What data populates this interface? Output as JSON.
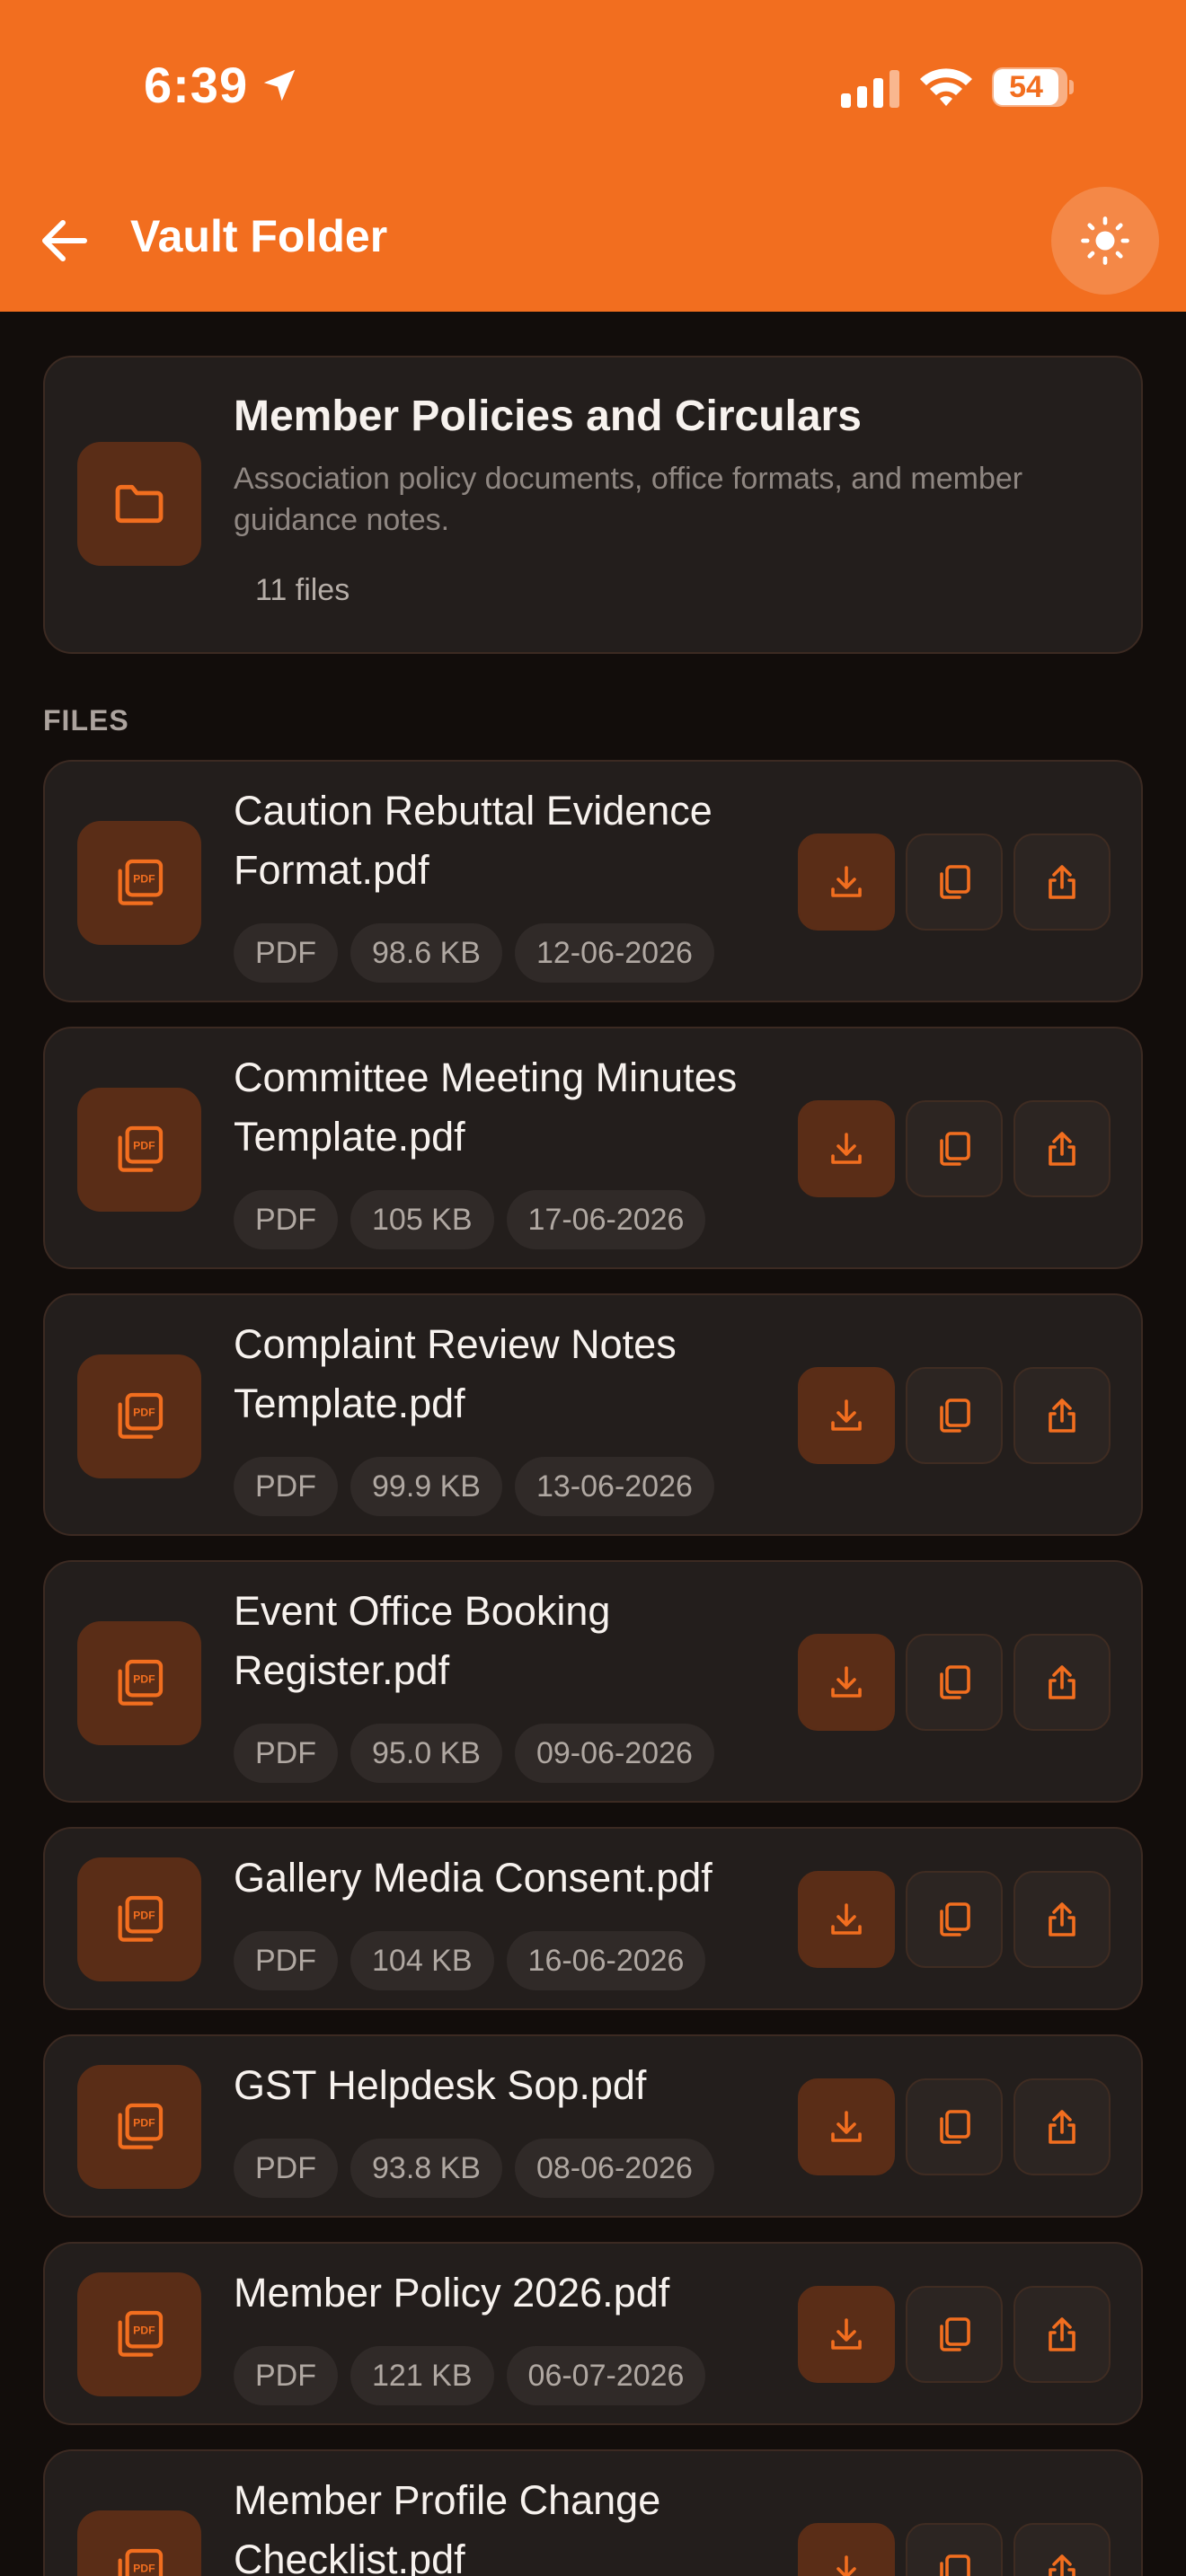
{
  "status": {
    "time": "6:39",
    "battery": "54"
  },
  "header": {
    "title": "Vault Folder"
  },
  "folder": {
    "name": "Member Policies and Circulars",
    "description": "Association policy documents, office formats, and member guidance notes.",
    "count": "11 files"
  },
  "section_label": "FILES",
  "files": [
    {
      "name": "Caution Rebuttal Evidence Format.pdf",
      "type": "PDF",
      "size": "98.6 KB",
      "date": "12-06-2026"
    },
    {
      "name": "Committee Meeting Minutes Template.pdf",
      "type": "PDF",
      "size": "105 KB",
      "date": "17-06-2026"
    },
    {
      "name": "Complaint Review Notes Template.pdf",
      "type": "PDF",
      "size": "99.9 KB",
      "date": "13-06-2026"
    },
    {
      "name": "Event Office Booking Register.pdf",
      "type": "PDF",
      "size": "95.0 KB",
      "date": "09-06-2026"
    },
    {
      "name": "Gallery Media Consent.pdf",
      "type": "PDF",
      "size": "104 KB",
      "date": "16-06-2026"
    },
    {
      "name": "GST Helpdesk Sop.pdf",
      "type": "PDF",
      "size": "93.8 KB",
      "date": "08-06-2026"
    },
    {
      "name": "Member Policy 2026.pdf",
      "type": "PDF",
      "size": "121 KB",
      "date": "06-07-2026"
    },
    {
      "name": "Member Profile Change Checklist.pdf",
      "type": "PDF",
      "size": "",
      "date": ""
    }
  ],
  "icons": {
    "back": "arrow-left-icon",
    "theme": "sun-icon",
    "folder": "folder-icon",
    "file": "pdf-stack-icon",
    "download": "download-icon",
    "copy": "copy-icon",
    "share": "share-icon"
  },
  "colors": {
    "accent": "#f26e1f",
    "background": "#120d0b",
    "card": "#231e1c",
    "tile": "#5a2d17"
  }
}
